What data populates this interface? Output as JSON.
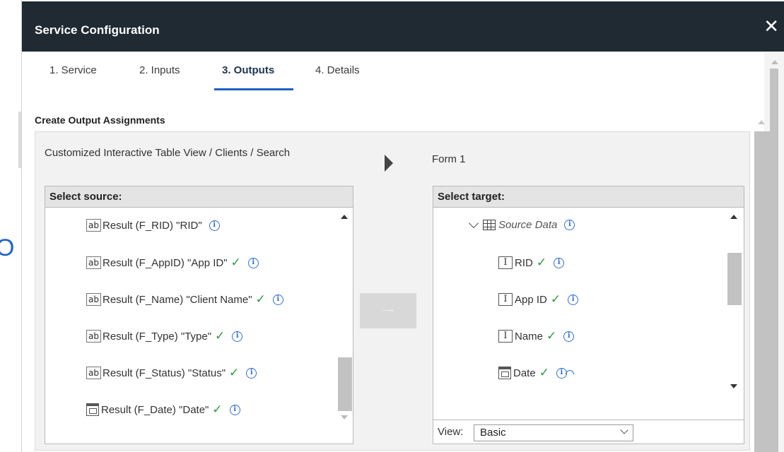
{
  "dialog": {
    "title": "Service Configuration",
    "close_glyph": "✕"
  },
  "tabs": [
    {
      "label": "1. Service"
    },
    {
      "label": "2. Inputs"
    },
    {
      "label": "3. Outputs",
      "active": true
    },
    {
      "label": "4. Details"
    }
  ],
  "section": {
    "title": "Create Output Assignments",
    "source_path": "Customized Interactive Table View / Clients / Search",
    "target_label": "Form 1"
  },
  "source": {
    "header": "Select source:",
    "items": [
      {
        "icon": "ab",
        "label": "Result (F_RID) \"RID\"",
        "checked": false
      },
      {
        "icon": "ab",
        "label": "Result (F_AppID) \"App ID\"",
        "checked": true
      },
      {
        "icon": "ab",
        "label": "Result (F_Name) \"Client Name\"",
        "checked": true
      },
      {
        "icon": "ab",
        "label": "Result (F_Type) \"Type\"",
        "checked": true
      },
      {
        "icon": "ab",
        "label": "Result (F_Status) \"Status\"",
        "checked": true
      },
      {
        "icon": "calendar",
        "label": "Result (F_Date) \"Date\"",
        "checked": true
      }
    ]
  },
  "map_button": {
    "label": "⟶"
  },
  "target": {
    "header": "Select target:",
    "group": "Source Data",
    "items": [
      {
        "icon": "text-field",
        "label": "RID",
        "checked": true
      },
      {
        "icon": "text-field",
        "label": "App ID",
        "checked": true
      },
      {
        "icon": "text-field",
        "label": "Name",
        "checked": true
      },
      {
        "icon": "calendar",
        "label": "Date",
        "checked": true
      }
    ],
    "view_label": "View:",
    "view_value": "Basic"
  },
  "glyphs": {
    "ab": "ab",
    "check": "✓",
    "info": "i",
    "text_field": "I"
  },
  "colors": {
    "titlebar": "#1f2a33",
    "accent": "#1e5fbf",
    "check": "#2e9a3e",
    "info": "#2f6fd6"
  }
}
